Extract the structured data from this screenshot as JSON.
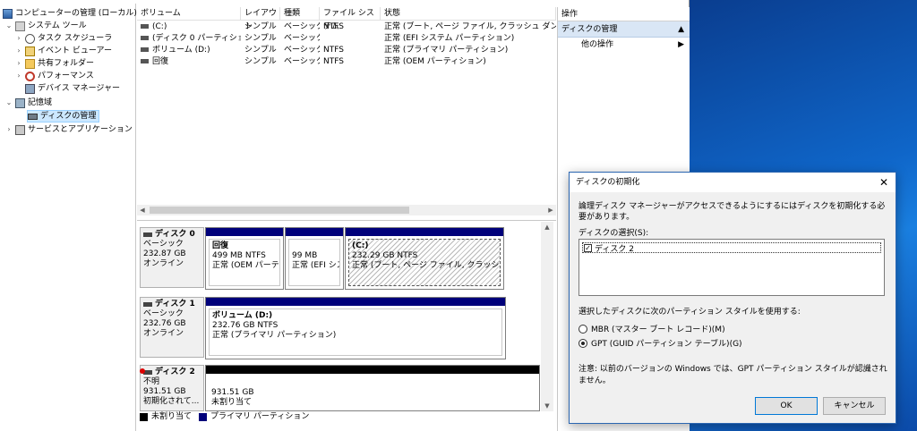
{
  "tree": {
    "root": "コンピューターの管理 (ローカル)",
    "system_tools": "システム ツール",
    "task_scheduler": "タスク スケジューラ",
    "event_viewer": "イベント ビューアー",
    "shared_folders": "共有フォルダー",
    "performance": "パフォーマンス",
    "device_manager": "デバイス マネージャー",
    "storage": "記憶域",
    "disk_management": "ディスクの管理",
    "services": "サービスとアプリケーション"
  },
  "volume_list": {
    "columns": [
      "ボリューム",
      "レイアウト",
      "種類",
      "ファイル システム",
      "状態"
    ],
    "rows": [
      {
        "volume": "(C:)",
        "layout": "シンプル",
        "type": "ベーシック",
        "fs": "NTFS",
        "status": "正常 (ブート, ページ ファイル, クラッシュ ダンプ, プライマ"
      },
      {
        "volume": "(ディスク 0 パーティション 2)",
        "layout": "シンプル",
        "type": "ベーシック",
        "fs": "",
        "status": "正常 (EFI システム パーティション)"
      },
      {
        "volume": "ボリューム (D:)",
        "layout": "シンプル",
        "type": "ベーシック",
        "fs": "NTFS",
        "status": "正常 (プライマリ パーティション)"
      },
      {
        "volume": "回復",
        "layout": "シンプル",
        "type": "ベーシック",
        "fs": "NTFS",
        "status": "正常 (OEM パーティション)"
      }
    ]
  },
  "disks": {
    "disk0": {
      "name": "ディスク 0",
      "type": "ベーシック",
      "size": "232.87 GB",
      "state": "オンライン"
    },
    "disk1": {
      "name": "ディスク 1",
      "type": "ベーシック",
      "size": "232.76 GB",
      "state": "オンライン"
    },
    "disk2": {
      "name": "ディスク 2",
      "type": "不明",
      "size": "931.51 GB",
      "state": "初期化されて..."
    }
  },
  "partitions": {
    "recovery": {
      "name": "回復",
      "size": "499 MB NTFS",
      "status": "正常 (OEM パーティシ"
    },
    "efi": {
      "size": "99 MB",
      "status": "正常 (EFI シス"
    },
    "c": {
      "name": "(C:)",
      "size": "232.29 GB NTFS",
      "status": "正常 (ブート, ページ ファイル, クラッシュ ダンプ, プ"
    },
    "d": {
      "name": "ボリューム (D:)",
      "size": "232.76 GB NTFS",
      "status": "正常 (プライマリ パーティション)"
    },
    "unallocated": {
      "size": "931.51 GB",
      "status": "未割り当て"
    }
  },
  "legend": {
    "unallocated": "未割り当て",
    "primary": "プライマリ パーティション"
  },
  "actions": {
    "header": "操作",
    "section": "ディスクの管理",
    "other": "他の操作"
  },
  "dialog": {
    "title": "ディスクの初期化",
    "message": "論理ディスク マネージャーがアクセスできるようにするにはディスクを初期化する必要があります。",
    "select_label": "ディスクの選択(S):",
    "disk_item": "ディスク 2",
    "style_label": "選択したディスクに次のパーティション スタイルを使用する:",
    "mbr": "MBR (マスター ブート レコード)(M)",
    "gpt": "GPT (GUID パーティション テーブル)(G)",
    "note": "注意: 以前のバージョンの Windows では、GPT パーティション スタイルが認識されません。",
    "ok": "OK",
    "cancel": "キャンセル",
    "selected_style": "GPT"
  },
  "colors": {
    "primary_partition": "#00007a",
    "unallocated": "#000000",
    "selection": "#cce8ff",
    "desktop": "#0f66c9"
  }
}
